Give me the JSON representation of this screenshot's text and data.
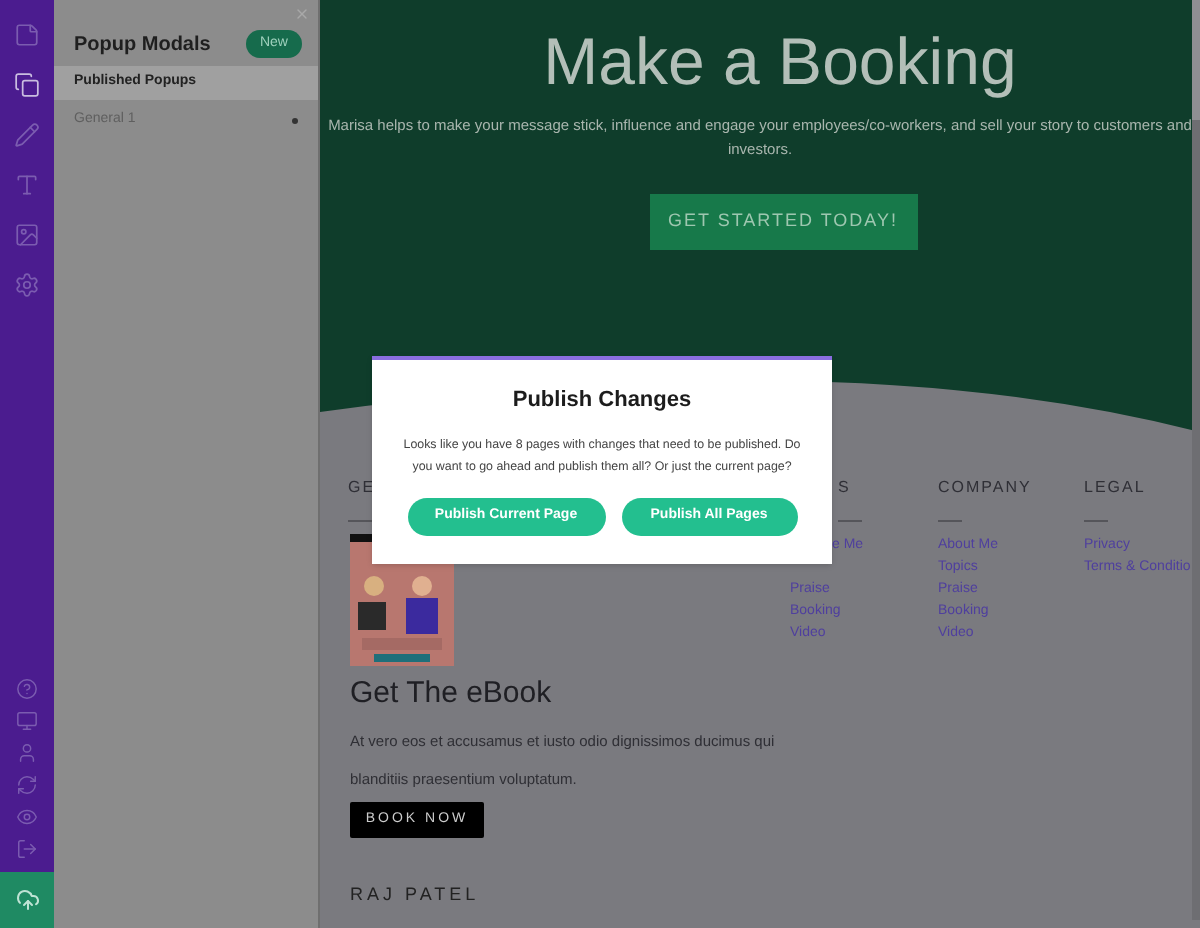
{
  "sidebar": {
    "items": [
      {
        "selected": false
      },
      {
        "selected": true
      },
      {
        "selected": false
      },
      {
        "selected": false
      },
      {
        "selected": false
      },
      {
        "selected": false
      }
    ]
  },
  "panel": {
    "title": "Popup Modals",
    "new_button": "New",
    "section": {
      "label": "Published Popups",
      "selected": true
    },
    "items": [
      {
        "label": "General 1"
      }
    ]
  },
  "hero": {
    "title": "Make a Booking",
    "text": "Marisa helps to make your message stick, influence and engage your employees/co-workers, and sell your story to customers and investors.",
    "button": "GET STARTED TODAY!"
  },
  "footer": {
    "column_1": {
      "heading": "GE",
      "ebook_title": "Get The eBook",
      "lines": [
        "At vero eos et accusamus et iusto odio dignissimos ducimus qui",
        "blanditiis praesentium voluptatum."
      ],
      "button": "BOOK NOW",
      "author": "RAJ PATEL"
    },
    "column_2": {
      "heading": "S",
      "links": [
        "e Me",
        "Praise",
        "Booking",
        "Video"
      ]
    },
    "column_3": {
      "heading": "COMPANY",
      "links": [
        "About Me",
        "Topics",
        "Praise",
        "Booking",
        "Video"
      ]
    },
    "column_4": {
      "heading": "LEGAL",
      "links": [
        "Privacy",
        "Terms & Conditio"
      ]
    }
  },
  "modal": {
    "title": "Publish Changes",
    "message": "Looks like you have 8 pages with changes that need to be published. Do you want to go ahead and publish them all? Or just the current page?",
    "buttons": [
      "Publish Current Page",
      "Publish All Pages"
    ]
  }
}
